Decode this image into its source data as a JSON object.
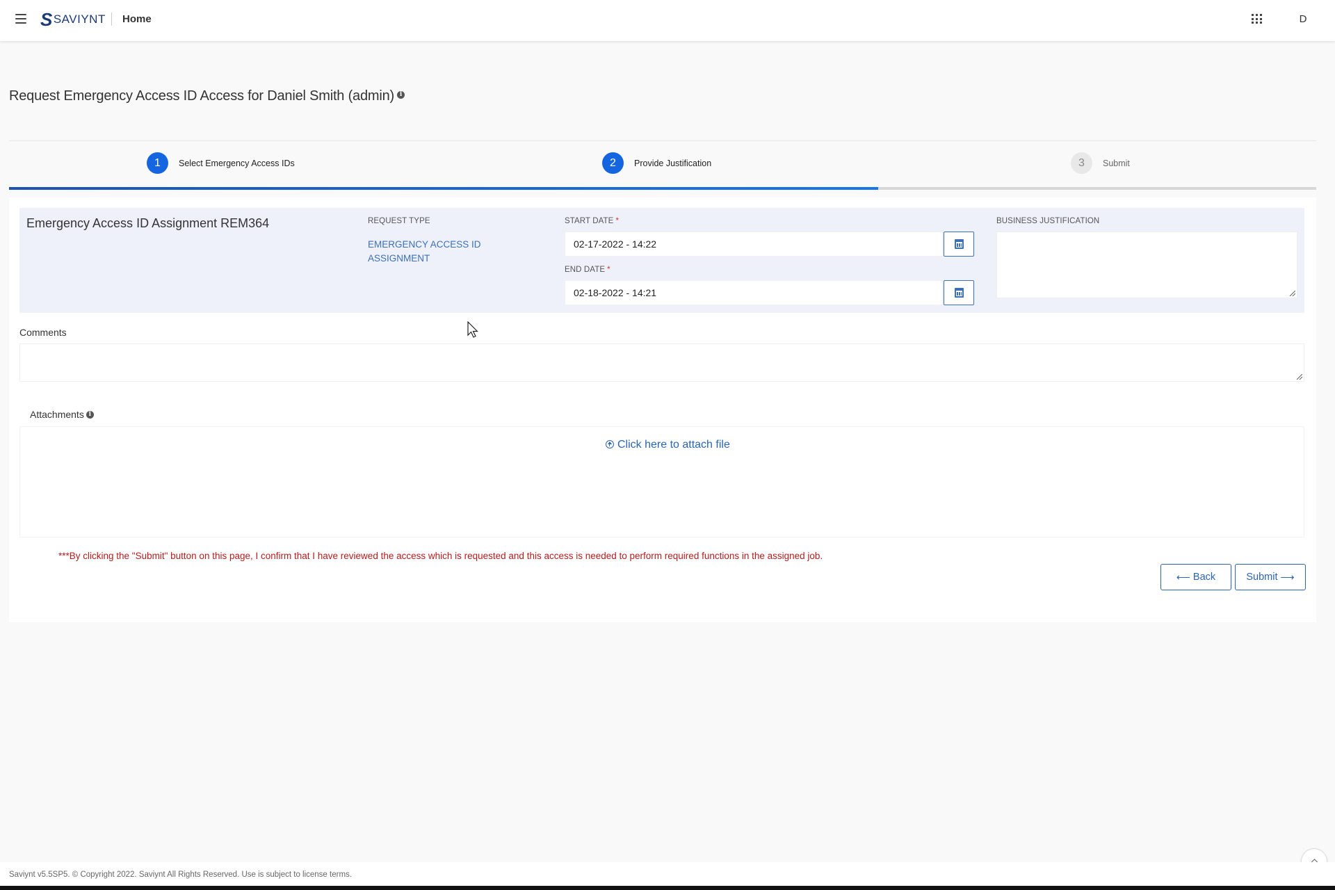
{
  "header": {
    "brand": "SAVIYNT",
    "breadcrumb": "Home",
    "avatar_initial": "D"
  },
  "page": {
    "title": "Request Emergency Access ID Access for Daniel Smith (admin)"
  },
  "stepper": {
    "steps": [
      {
        "number": "1",
        "label": "Select Emergency Access IDs",
        "state": "complete"
      },
      {
        "number": "2",
        "label": "Provide Justification",
        "state": "active"
      },
      {
        "number": "3",
        "label": "Submit",
        "state": "pending"
      }
    ],
    "progress_percent": 66.5
  },
  "assignment": {
    "title": "Emergency Access ID Assignment REM364",
    "request_type_label": "REQUEST TYPE",
    "request_type_value": "EMERGENCY ACCESS ID ASSIGNMENT",
    "start_date_label": "START DATE",
    "start_date_value": "02-17-2022 - 14:22",
    "end_date_label": "END DATE",
    "end_date_value": "02-18-2022 - 14:21",
    "required_marker": "*",
    "business_justification_label": "BUSINESS JUSTIFICATION"
  },
  "comments": {
    "label": "Comments"
  },
  "attachments": {
    "label": "Attachments",
    "attach_link": "Click here to attach file"
  },
  "disclaimer": "***By clicking the \"Submit\" button on this page, I confirm that I have reviewed the access which is requested and this access is needed to perform required functions in the assigned job.",
  "actions": {
    "back_label": "Back",
    "submit_label": "Submit"
  },
  "footer": {
    "text": "Saviynt v5.5SP5. © Copyright 2022. Saviynt All Rights Reserved. Use is subject to license terms."
  },
  "colors": {
    "accent": "#1565e0",
    "link": "#2a64b4",
    "required": "#d32f2f",
    "disclaimer": "#b71c1c"
  }
}
